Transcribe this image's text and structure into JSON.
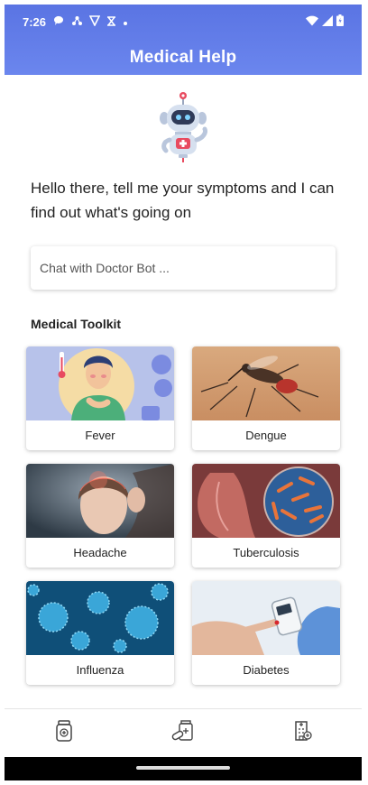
{
  "status_bar": {
    "time": "7:26",
    "left_icons": [
      "chat-bubble-icon",
      "network-icon",
      "shield-v-icon",
      "x-icon",
      "dot-icon"
    ],
    "right_icons": [
      "wifi-icon",
      "signal-icon",
      "battery-icon"
    ]
  },
  "header": {
    "title": "Medical Help"
  },
  "colors": {
    "header_gradient_top": "#5a74e3",
    "header_gradient_bottom": "#6b86ee",
    "bottom_bar": "#000000"
  },
  "greeting": "Hello there, tell me your symptoms and I can find out what's going on",
  "chat": {
    "placeholder": "Chat with Doctor Bot ..."
  },
  "toolkit": {
    "title": "Medical Toolkit",
    "items": [
      {
        "label": "Fever"
      },
      {
        "label": "Dengue"
      },
      {
        "label": "Headache"
      },
      {
        "label": "Tuberculosis"
      },
      {
        "label": "Influenza"
      },
      {
        "label": "Diabetes"
      }
    ]
  },
  "bottom_nav": {
    "items": [
      {
        "icon": "medicine-bottle-icon"
      },
      {
        "icon": "pills-icon"
      },
      {
        "icon": "hospital-icon"
      }
    ]
  }
}
